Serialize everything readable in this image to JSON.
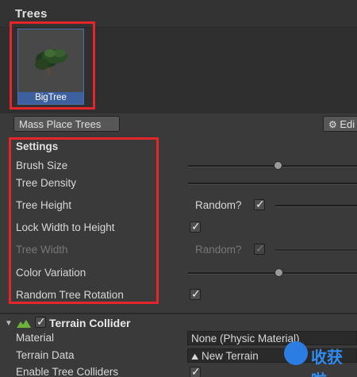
{
  "trees": {
    "title": "Trees",
    "items": [
      {
        "name": "BigTree"
      }
    ],
    "mass_place_label": "Mass Place Trees",
    "edit_label": "Edi"
  },
  "settings": {
    "title": "Settings",
    "brush_size": {
      "label": "Brush Size",
      "value": 0.49
    },
    "tree_density": {
      "label": "Tree Density",
      "value": 1.0
    },
    "tree_height": {
      "label": "Tree Height",
      "random_label": "Random?",
      "random": true
    },
    "lock_width": {
      "label": "Lock Width to Height",
      "checked": true
    },
    "tree_width": {
      "label": "Tree Width",
      "random_label": "Random?",
      "random": true,
      "disabled": true
    },
    "color_variation": {
      "label": "Color Variation",
      "value": 0.5
    },
    "random_rotation": {
      "label": "Random Tree Rotation",
      "checked": true
    }
  },
  "terrain_collider": {
    "title": "Terrain Collider",
    "enabled": true,
    "material_label": "Material",
    "material_value": "None (Physic Material)",
    "terrain_data_label": "Terrain Data",
    "terrain_data_value": "New Terrain",
    "enable_tree_colliders_label": "Enable Tree Colliders",
    "enable_tree_colliders": true
  },
  "watermark": {
    "text": "收获啦"
  },
  "colors": {
    "highlight": "#e4262a",
    "selected_tile": "#3d609e",
    "background": "#3a3a3a"
  }
}
